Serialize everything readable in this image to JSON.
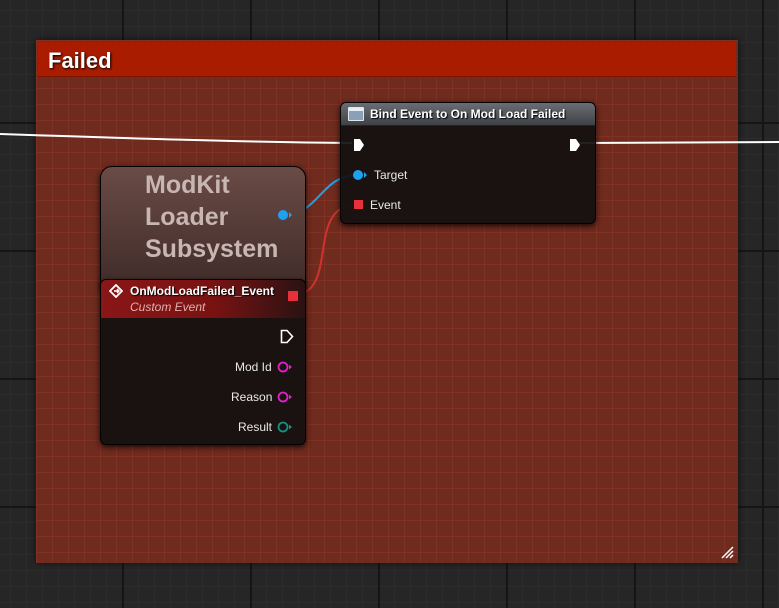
{
  "comment": {
    "title": "Failed",
    "header_color": "#a91c00",
    "body_color": "#6e2b1e"
  },
  "bind_node": {
    "title": "Bind Event to On Mod Load Failed",
    "icon": "function-icon",
    "pins": {
      "exec_in": "exec-pin",
      "exec_out": "exec-pin",
      "target": "Target",
      "event": "Event"
    }
  },
  "subsystem_node": {
    "label": "ModKit\nLoader\nSubsystem",
    "output_pin": "object-pin"
  },
  "event_node": {
    "title": "OnModLoadFailed_Event",
    "subtitle": "Custom Event",
    "icon": "event-icon",
    "delegate_pin_color": "#e8303a",
    "outputs": [
      {
        "label": "Mod Id",
        "pin_color": "#e020c8"
      },
      {
        "label": "Reason",
        "pin_color": "#e020c8"
      },
      {
        "label": "Result",
        "pin_color": "#1a8f80"
      }
    ]
  },
  "colors": {
    "exec_wire": "#ffffff",
    "object_wire": "#1da2f0",
    "delegate_wire": "#d2322e"
  }
}
